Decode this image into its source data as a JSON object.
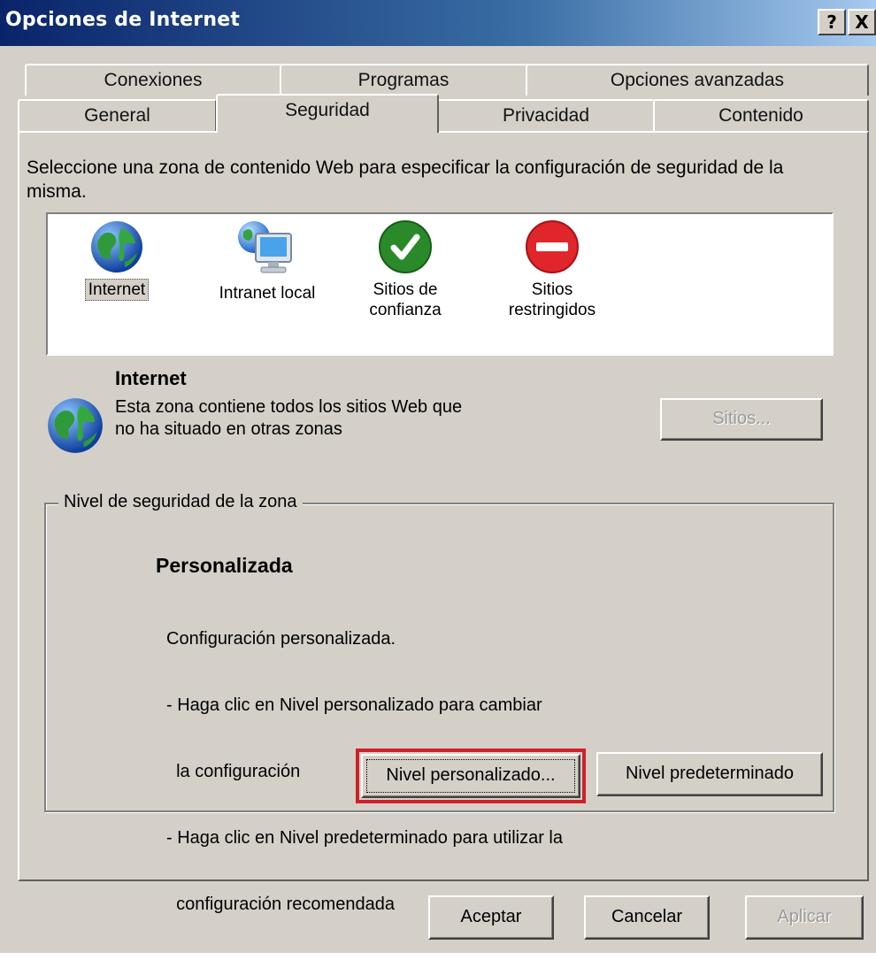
{
  "window": {
    "title": "Opciones de Internet",
    "help_label": "?",
    "close_label": "X"
  },
  "tabs": {
    "row_back": [
      "Conexiones",
      "Programas",
      "Opciones avanzadas"
    ],
    "row_front": [
      "General",
      "Seguridad",
      "Privacidad",
      "Contenido"
    ],
    "active": "Seguridad"
  },
  "security": {
    "instruction": "Seleccione una zona de contenido Web para especificar la configuración de seguridad de la misma.",
    "zones": [
      {
        "label": "Internet",
        "icon": "globe-icon",
        "selected": true
      },
      {
        "label": "Intranet local",
        "icon": "intranet-computer-icon",
        "selected": false
      },
      {
        "label": "Sitios de confianza",
        "icon": "trusted-checkmark-icon",
        "selected": false
      },
      {
        "label": "Sitios restringidos",
        "icon": "restricted-no-entry-icon",
        "selected": false
      }
    ],
    "selected_zone": {
      "name": "Internet",
      "description": "Esta zona contiene todos los sitios Web que no ha situado en otras zonas"
    },
    "sites_button": "Sitios...",
    "level_group": {
      "legend": "Nivel de seguridad de la zona",
      "level_name": "Personalizada",
      "lines": [
        "Configuración personalizada.",
        "- Haga clic en Nivel personalizado para cambiar",
        "  la configuración",
        "- Haga clic en Nivel predeterminado para utilizar la",
        "  configuración recomendada"
      ],
      "custom_button": "Nivel personalizado...",
      "default_button": "Nivel predeterminado"
    }
  },
  "footer": {
    "ok": "Aceptar",
    "cancel": "Cancelar",
    "apply": "Aplicar"
  },
  "colors": {
    "highlight": "#d11f2a",
    "dialog_bg": "#d4d0c8",
    "title_start": "#0a246a"
  }
}
